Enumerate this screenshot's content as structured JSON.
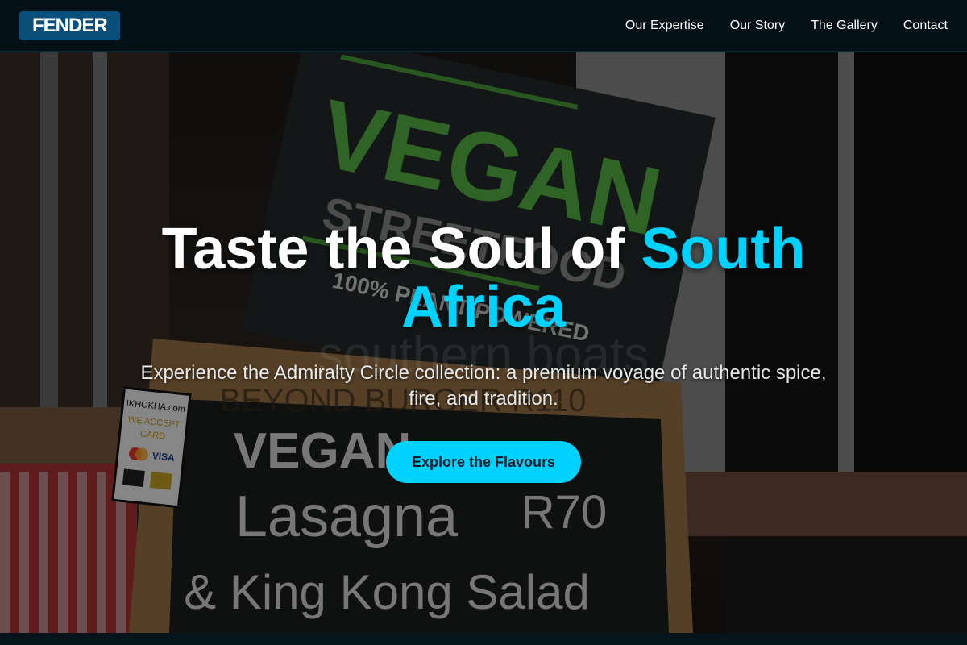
{
  "brand": {
    "logo": "FENDER"
  },
  "nav": {
    "items": [
      {
        "label": "Our Expertise"
      },
      {
        "label": "Our Story"
      },
      {
        "label": "The Gallery"
      },
      {
        "label": "Contact"
      }
    ]
  },
  "hero": {
    "title_main": "Taste the Soul of ",
    "title_accent": "South Africa",
    "watermark": "southern boats",
    "subtitle": "Experience the Admiralty Circle collection: a premium voyage of authentic spice, fire, and tradition.",
    "cta_label": "Explore the Flavours",
    "sign_top": {
      "line1": "VEGAN",
      "line2": "STREETFOOD",
      "line3": "100% PLANT POWERED"
    },
    "sign_board": {
      "header": "BEYOND BURGER R110",
      "line1": "VEGAN",
      "line1_suffix": "Lasagne",
      "price": "R70",
      "line2": "Lasagna",
      "line3": "& King Kong Salad"
    },
    "card_sign": {
      "brand": "IKHOKHA.com",
      "text1": "WE ACCEPT",
      "text2": "CARD",
      "visa": "VISA"
    }
  },
  "colors": {
    "accent": "#00d2ff",
    "navbar": "#041218",
    "logo_bg": "#0a4f7a"
  }
}
